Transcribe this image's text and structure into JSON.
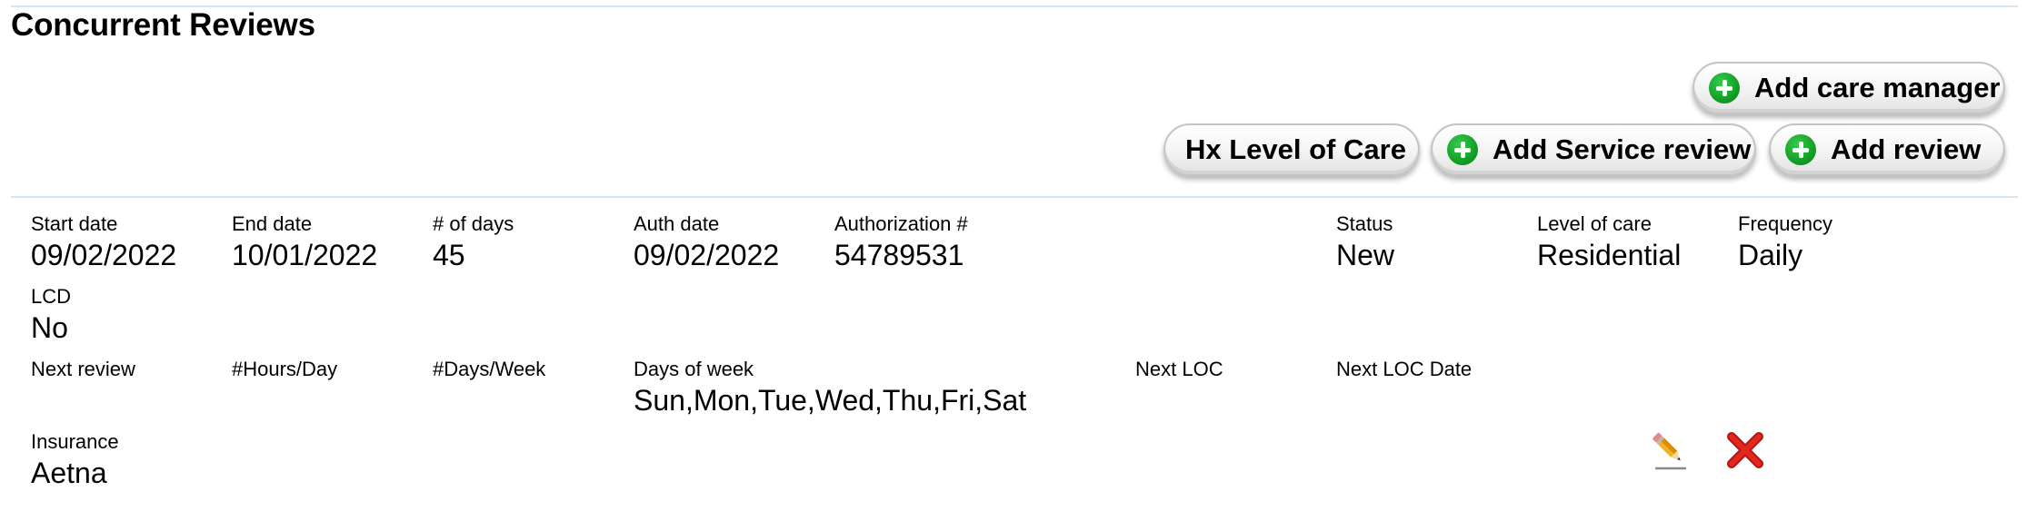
{
  "header": {
    "title": "Concurrent Reviews"
  },
  "actions": {
    "add_care_manager": "Add care manager",
    "hx_level_of_care": "Hx Level of Care",
    "add_service_review": "Add Service review",
    "add_review": "Add review"
  },
  "review": {
    "start_date": {
      "label": "Start date",
      "value": "09/02/2022"
    },
    "end_date": {
      "label": "End date",
      "value": "10/01/2022"
    },
    "num_days": {
      "label": "# of days",
      "value": "45"
    },
    "auth_date": {
      "label": "Auth date",
      "value": "09/02/2022"
    },
    "authorization": {
      "label": "Authorization #",
      "value": "54789531"
    },
    "status": {
      "label": "Status",
      "value": "New"
    },
    "level_of_care": {
      "label": "Level of care",
      "value": "Residential"
    },
    "frequency": {
      "label": "Frequency",
      "value": "Daily"
    },
    "lcd": {
      "label": "LCD",
      "value": "No"
    },
    "next_review": {
      "label": "Next review",
      "value": ""
    },
    "hours_per_day": {
      "label": "#Hours/Day",
      "value": ""
    },
    "days_per_week": {
      "label": "#Days/Week",
      "value": ""
    },
    "days_of_week": {
      "label": "Days of week",
      "value": "Sun,Mon,Tue,Wed,Thu,Fri,Sat"
    },
    "next_loc": {
      "label": "Next LOC",
      "value": ""
    },
    "next_loc_date": {
      "label": "Next LOC Date",
      "value": ""
    },
    "insurance": {
      "label": "Insurance",
      "value": "Aetna"
    }
  },
  "icons": {
    "add": "plus-circle-icon",
    "edit": "pencil-icon",
    "delete": "red-x-icon"
  },
  "colors": {
    "add_icon": "#15a42a",
    "delete_icon": "#d9221c",
    "rule": "#d6e3f0"
  }
}
